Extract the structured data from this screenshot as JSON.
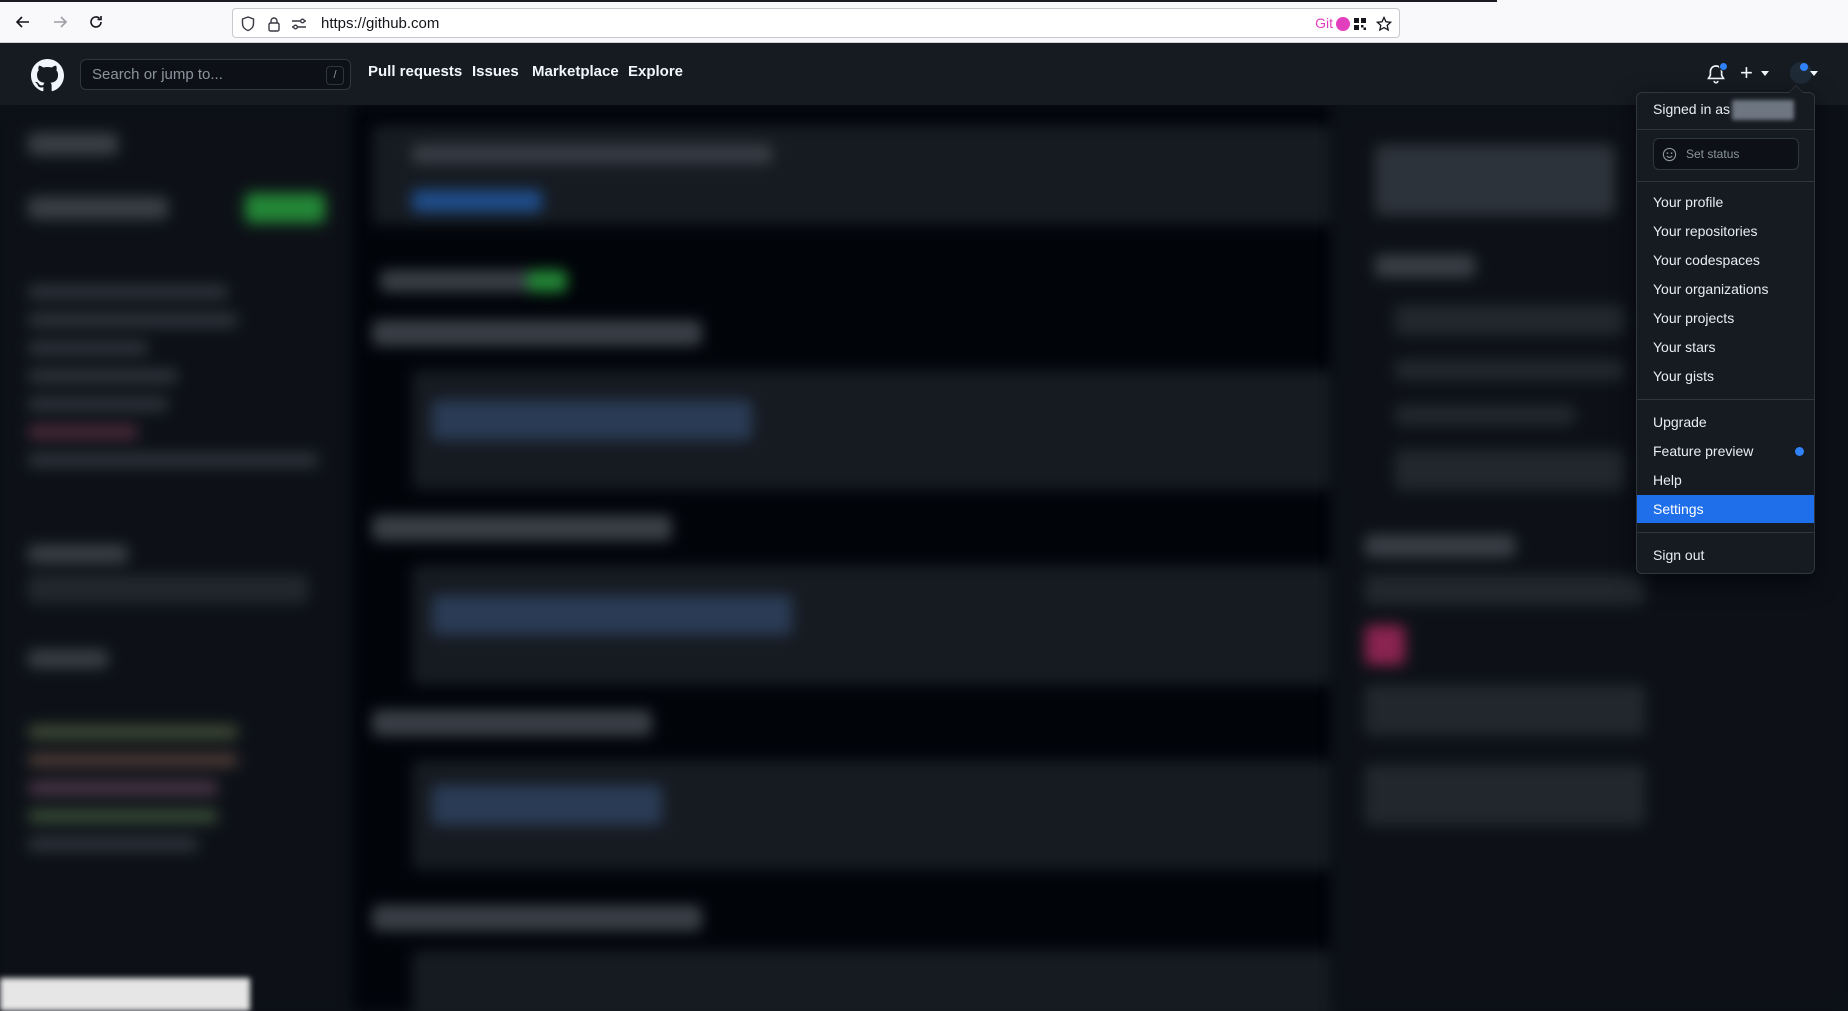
{
  "browser": {
    "url": "https://github.com",
    "git_badge": "Git"
  },
  "header": {
    "search_placeholder": "Search or jump to...",
    "search_shortcut": "/",
    "nav": [
      "Pull requests",
      "Issues",
      "Marketplace",
      "Explore"
    ]
  },
  "dropdown": {
    "signed_in_as": "Signed in as",
    "set_status": "Set status",
    "profile_items": [
      "Your profile",
      "Your repositories",
      "Your codespaces",
      "Your organizations",
      "Your projects",
      "Your stars",
      "Your gists"
    ],
    "misc_items": [
      "Upgrade",
      "Feature preview",
      "Help",
      "Settings"
    ],
    "active_item": "Settings",
    "sign_out": "Sign out"
  },
  "colors": {
    "accent": "#1f6feb",
    "header_bg": "#161b22",
    "page_bg": "#0d1117"
  }
}
